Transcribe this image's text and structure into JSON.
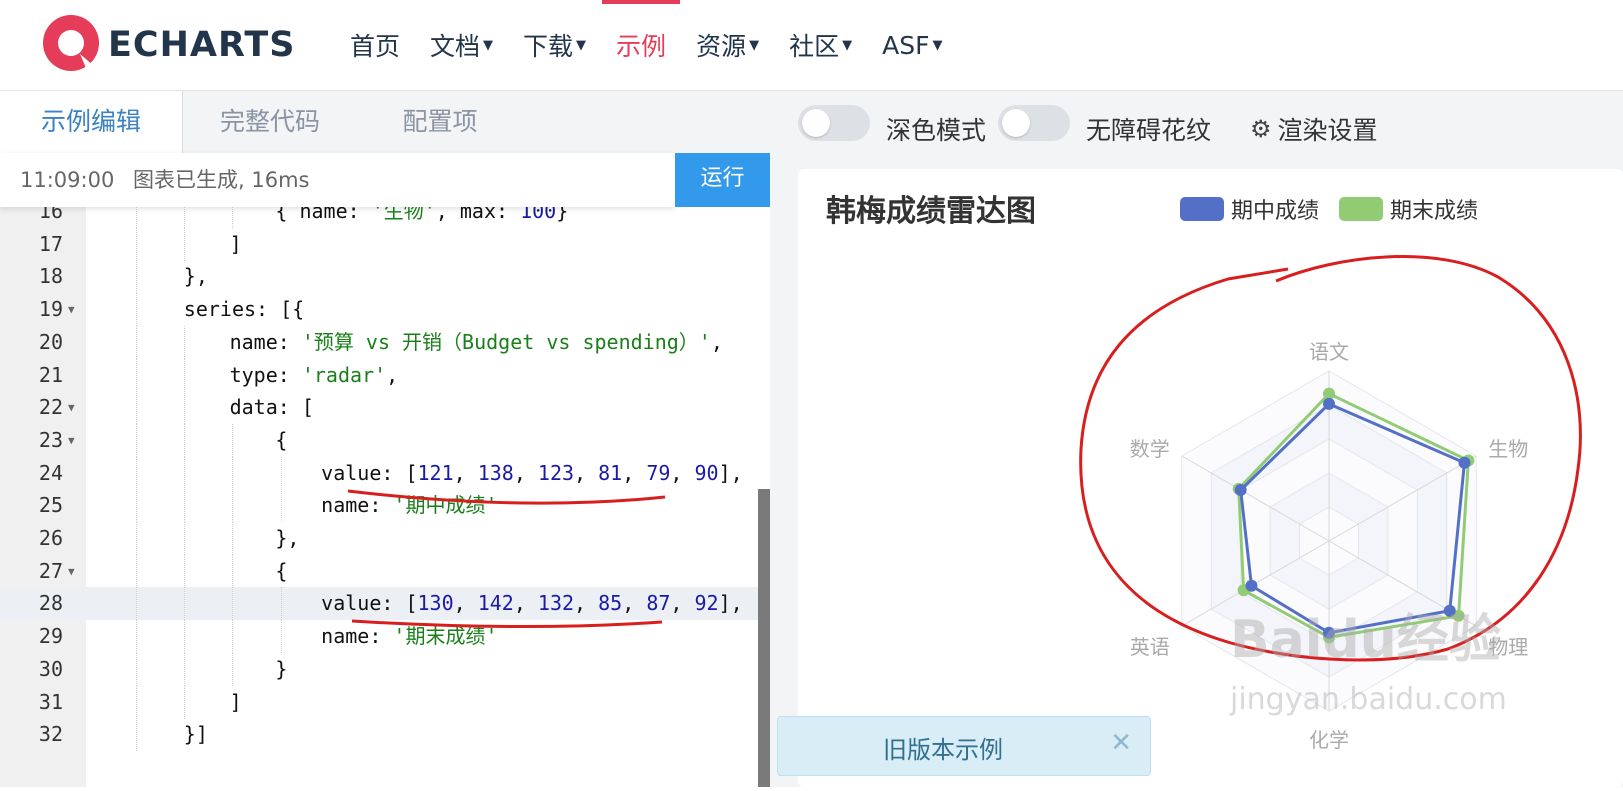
{
  "header": {
    "logo_text": "ECHARTS",
    "nav": [
      {
        "label": "首页",
        "dropdown": false,
        "active": false
      },
      {
        "label": "文档",
        "dropdown": true,
        "active": false
      },
      {
        "label": "下载",
        "dropdown": true,
        "active": false
      },
      {
        "label": "示例",
        "dropdown": false,
        "active": true
      },
      {
        "label": "资源",
        "dropdown": true,
        "active": false
      },
      {
        "label": "社区",
        "dropdown": true,
        "active": false
      },
      {
        "label": "ASF",
        "dropdown": true,
        "active": false
      }
    ]
  },
  "editor_tabs": [
    "示例编辑",
    "完整代码",
    "配置项"
  ],
  "status": {
    "time": "11:09:00",
    "message": "图表已生成, 16ms"
  },
  "run_button": "运行",
  "code_lines": [
    {
      "num": "16",
      "fold": false,
      "text": "{ name: '生物', max: 100}"
    },
    {
      "num": "17",
      "fold": false,
      "text": "]"
    },
    {
      "num": "18",
      "fold": false,
      "text": "},"
    },
    {
      "num": "19",
      "fold": true,
      "text": "series: [{"
    },
    {
      "num": "20",
      "fold": false,
      "text": "name: '预算 vs 开销（Budget vs spending）',"
    },
    {
      "num": "21",
      "fold": false,
      "text": "type: 'radar',"
    },
    {
      "num": "22",
      "fold": true,
      "text": "data: ["
    },
    {
      "num": "23",
      "fold": true,
      "text": "{"
    },
    {
      "num": "24",
      "fold": false,
      "text": "value: [121, 138, 123, 81, 79, 90],"
    },
    {
      "num": "25",
      "fold": false,
      "text": "name: '期中成绩'"
    },
    {
      "num": "26",
      "fold": false,
      "text": "},"
    },
    {
      "num": "27",
      "fold": true,
      "text": "{"
    },
    {
      "num": "28",
      "fold": false,
      "text": "value: [130, 142, 132, 85, 87, 92],"
    },
    {
      "num": "29",
      "fold": false,
      "text": "name: '期末成绩'"
    },
    {
      "num": "30",
      "fold": false,
      "text": "}"
    },
    {
      "num": "31",
      "fold": false,
      "text": "]"
    },
    {
      "num": "32",
      "fold": false,
      "text": "}]"
    }
  ],
  "right_toolbar": {
    "dark_mode": "深色模式",
    "decal": "无障碍花纹",
    "render_settings": "渲染设置"
  },
  "chart": {
    "title": "韩梅成绩雷达图",
    "legend": [
      "期中成绩",
      "期末成绩"
    ],
    "indicators": [
      "语文",
      "生物",
      "物理",
      "化学",
      "英语",
      "数学"
    ],
    "colors": {
      "series1": "#5470c6",
      "series2": "#91cc75",
      "annotation": "#d81e1e"
    }
  },
  "chart_data": {
    "type": "radar",
    "title": "韩梅成绩雷达图",
    "indicators": [
      "语文",
      "生物",
      "物理",
      "化学",
      "英语",
      "数学"
    ],
    "series": [
      {
        "name": "期中成绩",
        "values": [
          121,
          138,
          123,
          81,
          79,
          90
        ]
      },
      {
        "name": "期末成绩",
        "values": [
          130,
          142,
          132,
          85,
          87,
          92
        ]
      }
    ],
    "legend_position": "top"
  },
  "old_version_banner": "旧版本示例",
  "watermark": "Baidu经验 jingyan.baidu.com"
}
